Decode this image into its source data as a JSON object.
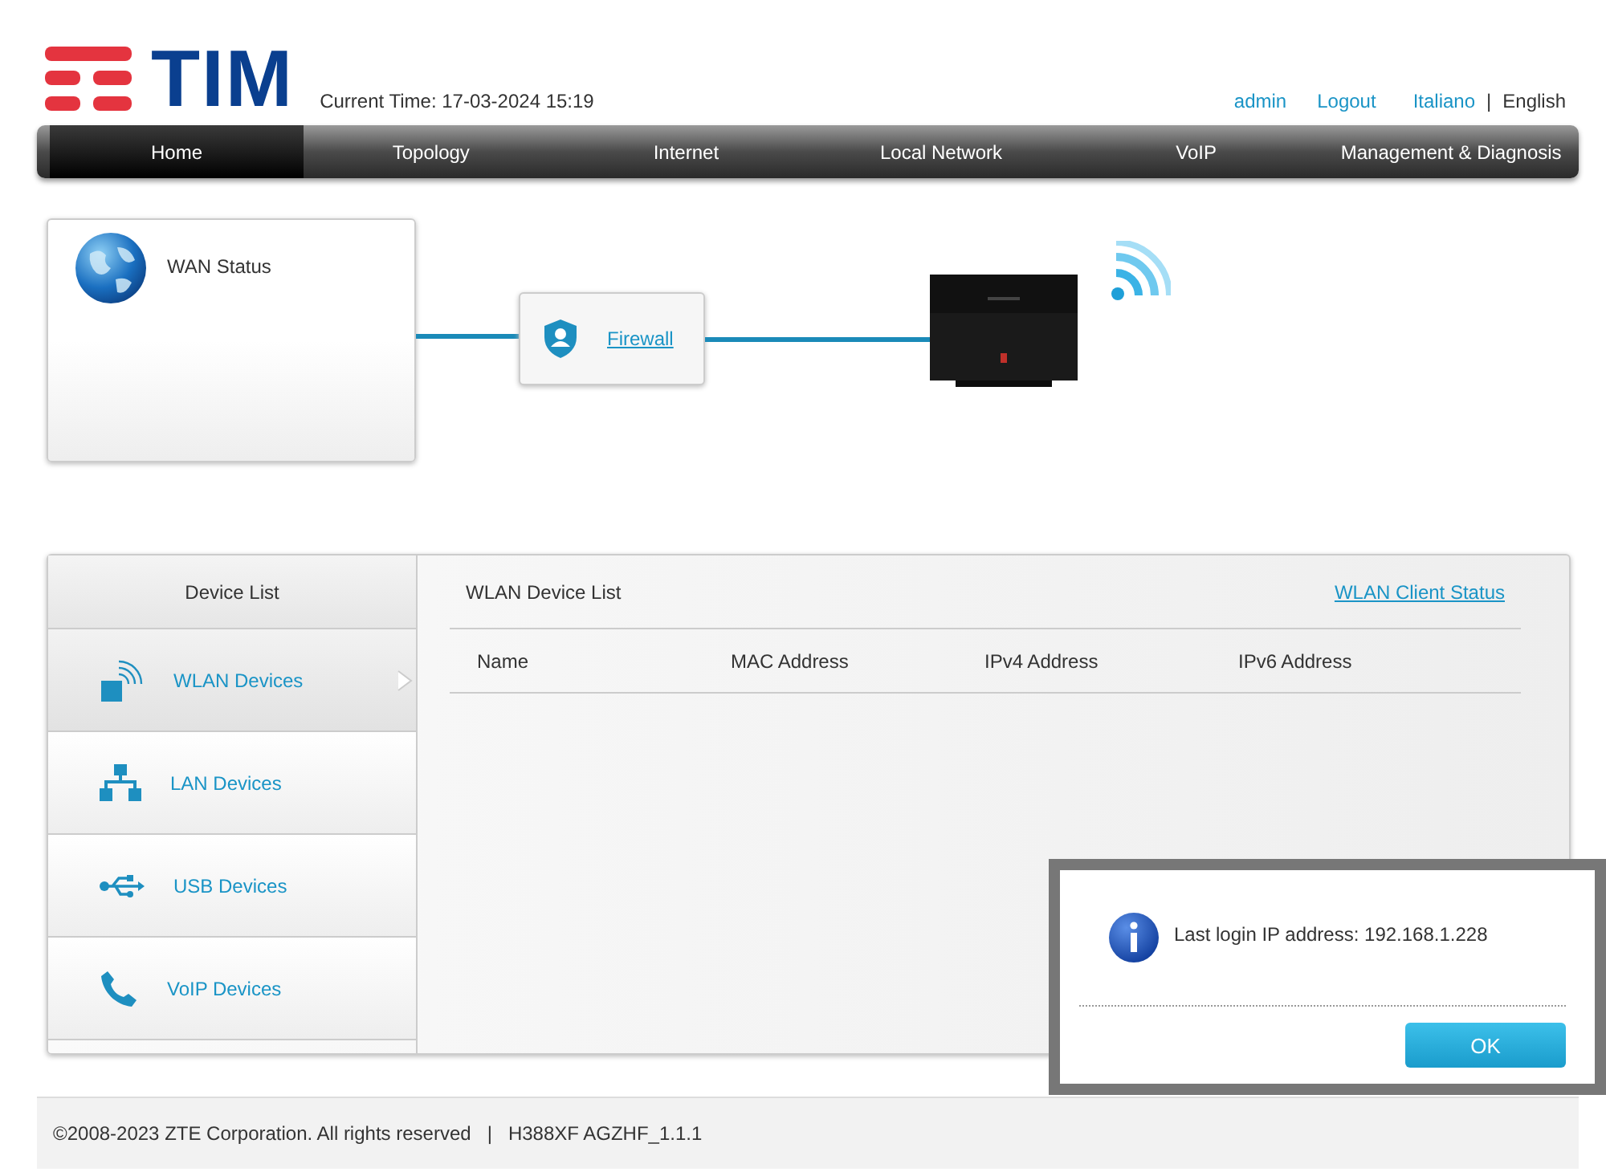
{
  "header": {
    "logo_text": "TIM",
    "current_time": "Current Time: 17-03-2024 15:19",
    "user": "admin",
    "logout": "Logout",
    "languages": [
      {
        "label": "Italiano",
        "selected": false
      },
      {
        "label": "English",
        "selected": true
      }
    ],
    "separator": "|"
  },
  "nav": [
    {
      "label": "Home",
      "selected": true
    },
    {
      "label": "Topology",
      "selected": false
    },
    {
      "label": "Internet",
      "selected": false
    },
    {
      "label": "Local Network",
      "selected": false
    },
    {
      "label": "VoIP",
      "selected": false
    },
    {
      "label": "Management & Diagnosis",
      "selected": false
    }
  ],
  "topology": {
    "wan": "WAN Status",
    "firewall": "Firewall"
  },
  "device_list": {
    "title": "Device List",
    "items": [
      {
        "label": "WLAN Devices",
        "kind": "wlan",
        "selected": true
      },
      {
        "label": "LAN Devices",
        "kind": "lan",
        "selected": false
      },
      {
        "label": "USB Devices",
        "kind": "usb",
        "selected": false
      },
      {
        "label": "VoIP Devices",
        "kind": "voip",
        "selected": false
      }
    ],
    "panel_title": "WLAN Device List",
    "panel_link": "WLAN Client Status",
    "columns": [
      "Name",
      "MAC Address",
      "IPv4 Address",
      "IPv6 Address"
    ]
  },
  "footer": {
    "copyright": "©2008-2023 ZTE Corporation. All rights reserved",
    "separator": "|",
    "version": "H388XF AGZHF_1.1.1"
  },
  "dialog": {
    "message": "Last login IP address: 192.168.1.228",
    "button": "OK"
  }
}
